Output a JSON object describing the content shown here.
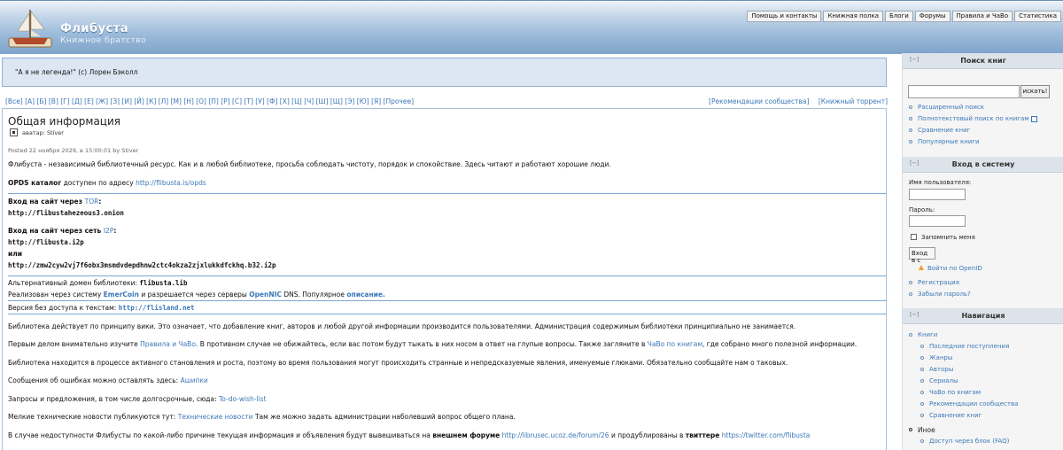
{
  "header": {
    "site_name": "Флибуста",
    "slogan": "Книжное братство",
    "top_links": [
      "Помощь и контакты",
      "Книжная полка",
      "Блоги",
      "Форумы",
      "Правила и ЧаВо",
      "Статистика"
    ]
  },
  "quote": "\"А я не легенда!\" (c) Лорен Бэколл",
  "alphabet": "[Все] [А] [Б] [В] [Г] [Д] [Е] [Ж] [З] [И] [Й] [К] [Л] [М] [Н] [О] [П] [Р] [С] [Т] [У] [Ф] [Х] [Ц] [Ч] [Ш] [Щ] [Э] [Ю] [Я] [Прочее]",
  "alpha_right": [
    "[Рекомендации сообщества]",
    "[Книжный торрент]"
  ],
  "article": {
    "title": "Общая информация",
    "avatar_label": "аватар: Stiver",
    "posted": "Posted 22 ноября 2029, в 15:00:01 by Stiver",
    "intro": "Флибуста - независимый библиотечный ресурс. Как и в любой библиотеке, просьба соблюдать чистоту, порядок и спокойствие. Здесь читают и работают хорошие люди.",
    "opds_bold": "OPDS каталог",
    "opds_text": " доступен по адресу ",
    "opds_url": "http://flibusta.is/opds",
    "tor_label": "Вход на сайт через ",
    "tor_link": "TOR",
    "tor_url": "http://flibustahezeous3.onion",
    "i2p_label": "Вход на сайт через сеть ",
    "i2p_link": "I2P",
    "i2p_url": "http://flibusta.i2p",
    "or": "или",
    "i2p_url2": "http://zmw2cyw2vj7f6obx3msmdvdepdhnw2ctc4okza2zjxlukkdfckhq.b32.i2p",
    "alt_domain_text": "Альтернативный домен библиотеки: ",
    "alt_domain": "flibusta.lib",
    "emer_1": "Реализован через систему ",
    "emer_link": "EmerCoin",
    "emer_2": " и разрешается через серверы ",
    "opennic_link": "OpenNIC",
    "emer_3": " DNS. Популярное ",
    "desc_link": "описание.",
    "noaccess_text": "Версия без доступа к текстам: ",
    "noaccess_url": "http://flisland.net",
    "p_wiki": "Библиотека действует по принципу вики. Это означает, что добавление книг, авторов и любой другой информации производится пользователями. Администрация содержимым библиотеки принципиально не занимается.",
    "p_rules_1": "Первым делом внимательно изучите ",
    "p_rules_link": "Правила и ЧаВо",
    "p_rules_2": ". В противном случае не обижайтесь, если вас потом будут тыкать в них носом в ответ на глупые вопросы. Также загляните в ",
    "p_rules_link2": "ЧаВо по книгам",
    "p_rules_3": ", где собрано много полезной информации.",
    "p_dev": "Библиотека находится в процессе активного становления и роста, поэтому во время пользования могут происходить странные и непредсказуемые явления, именуемые глюками. Обязательно сообщайте нам о таковых.",
    "p_bugs_1": "Сообщения об ошибках можно оставлять здесь: ",
    "p_bugs_link": "Ашипки",
    "p_wish_1": "Запросы и предложения, в том числе долгосрочные, сюда: ",
    "p_wish_link": "To-do-wish-list",
    "p_tech_1": "Мелкие технические новости публикуются тут: ",
    "p_tech_link": "Технические новости",
    "p_tech_2": " Там же можно задать администрации наболевший вопрос общего плана.",
    "p_forum_1": "В случае недоступности Флибусты по какой-либо причине текущая информация и объявления будут вывешиваться на ",
    "p_forum_bold": "внешнем форуме",
    "p_forum_link": "http://librusec.ucoz.de/forum/26",
    "p_forum_2": " и продублированы в ",
    "p_forum_bold2": "твиттере",
    "p_forum_link2": "https://twitter.com/flibusta"
  },
  "sidebar": {
    "collapse": "[−]",
    "search": {
      "title": "Поиск книг",
      "button": "искать!",
      "links": [
        "Расширенный поиск",
        "Полнотекстовый поиск по книгам",
        "Сравнение книг",
        "Популярные книги"
      ]
    },
    "login": {
      "title": "Вход в систему",
      "username_label": "Имя пользователя:",
      "password_label": "Пароль:",
      "remember": "Запомнить меня",
      "submit": "Вход в с",
      "openid": "Войти по OpenID",
      "links": [
        "Регистрация",
        "Забыли пароль?"
      ]
    },
    "nav": {
      "title": "Навигация",
      "books": "Книги",
      "book_items": [
        "Последние поступления",
        "Жанры",
        "Авторы",
        "Сериалы",
        "ЧаВо по книгам",
        "Рекомендации сообщества",
        "Сравнение книг"
      ],
      "other": "Иное",
      "other_items": [
        "Доступ через блок (FAQ)"
      ]
    }
  }
}
